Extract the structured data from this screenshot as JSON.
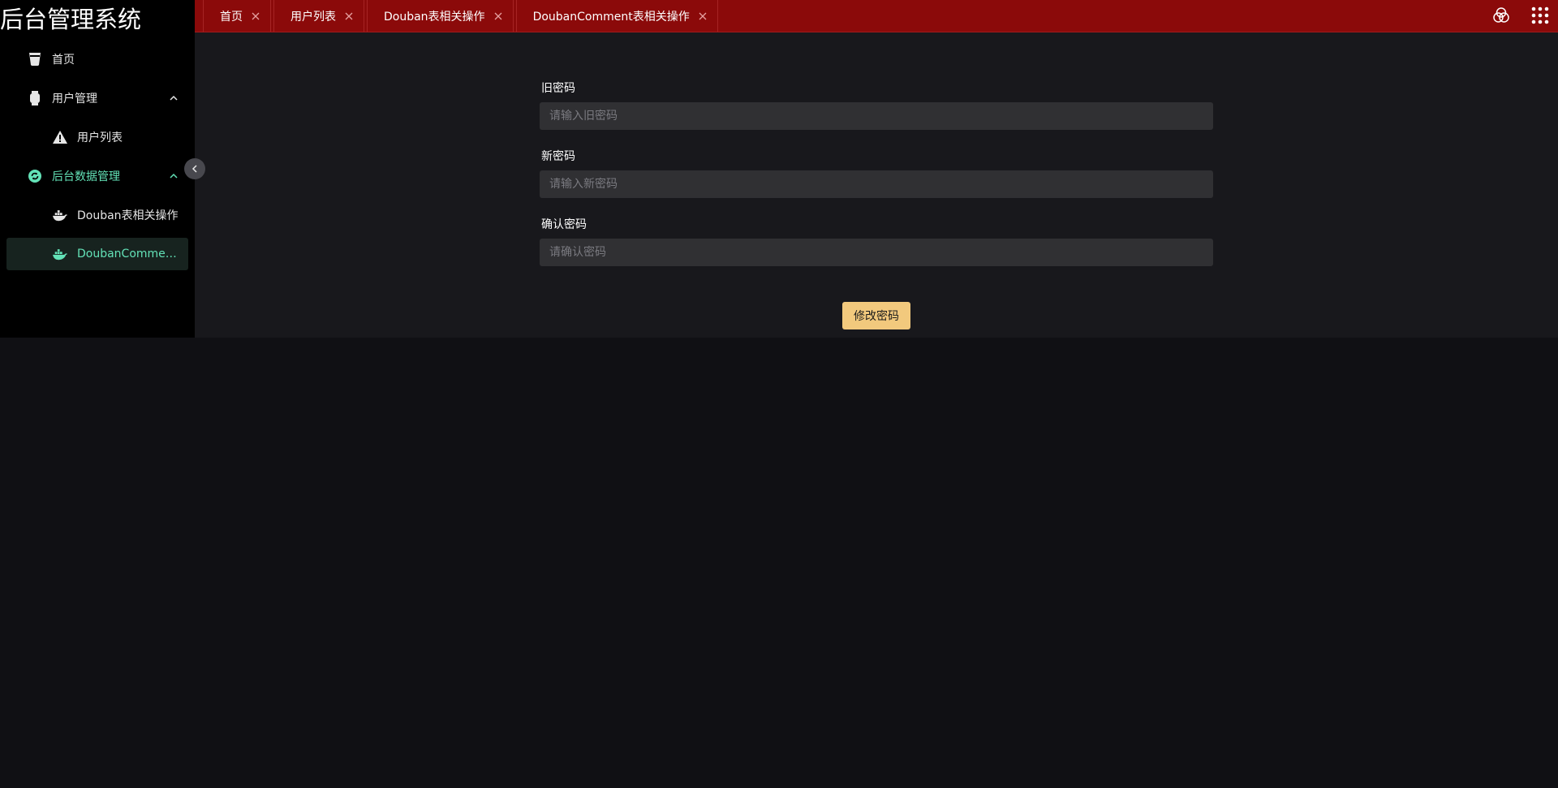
{
  "app": {
    "title": "后台管理系统"
  },
  "colors": {
    "header_bg": "#8b0a0a",
    "accent": "#63e2b7",
    "button_bg": "#f2c97d",
    "sidebar_bg": "#000000",
    "content_bg": "#18181c",
    "page_bg": "#101014"
  },
  "sidebar": {
    "items": [
      {
        "label": "首页",
        "icon": "cup-icon"
      },
      {
        "label": "用户管理",
        "icon": "watch-icon",
        "expanded": true
      },
      {
        "label": "用户列表",
        "icon": "warning-icon"
      },
      {
        "label": "后台数据管理",
        "icon": "refresh-circle-icon",
        "expanded": true
      },
      {
        "label": "Douban表相关操作",
        "icon": "docker-icon"
      },
      {
        "label": "DoubanCommen...",
        "icon": "docker-icon",
        "active": true
      }
    ]
  },
  "header": {
    "tabs": [
      {
        "label": "首页"
      },
      {
        "label": "用户列表"
      },
      {
        "label": "Douban表相关操作"
      },
      {
        "label": "DoubanComment表相关操作",
        "active": true
      }
    ],
    "icons": [
      "color-theme-icon",
      "grid-menu-icon"
    ]
  },
  "form": {
    "old_password": {
      "label": "旧密码",
      "placeholder": "请输入旧密码",
      "value": ""
    },
    "new_password": {
      "label": "新密码",
      "placeholder": "请输入新密码",
      "value": ""
    },
    "confirm_password": {
      "label": "确认密码",
      "placeholder": "请确认密码",
      "value": ""
    },
    "submit_label": "修改密码"
  }
}
